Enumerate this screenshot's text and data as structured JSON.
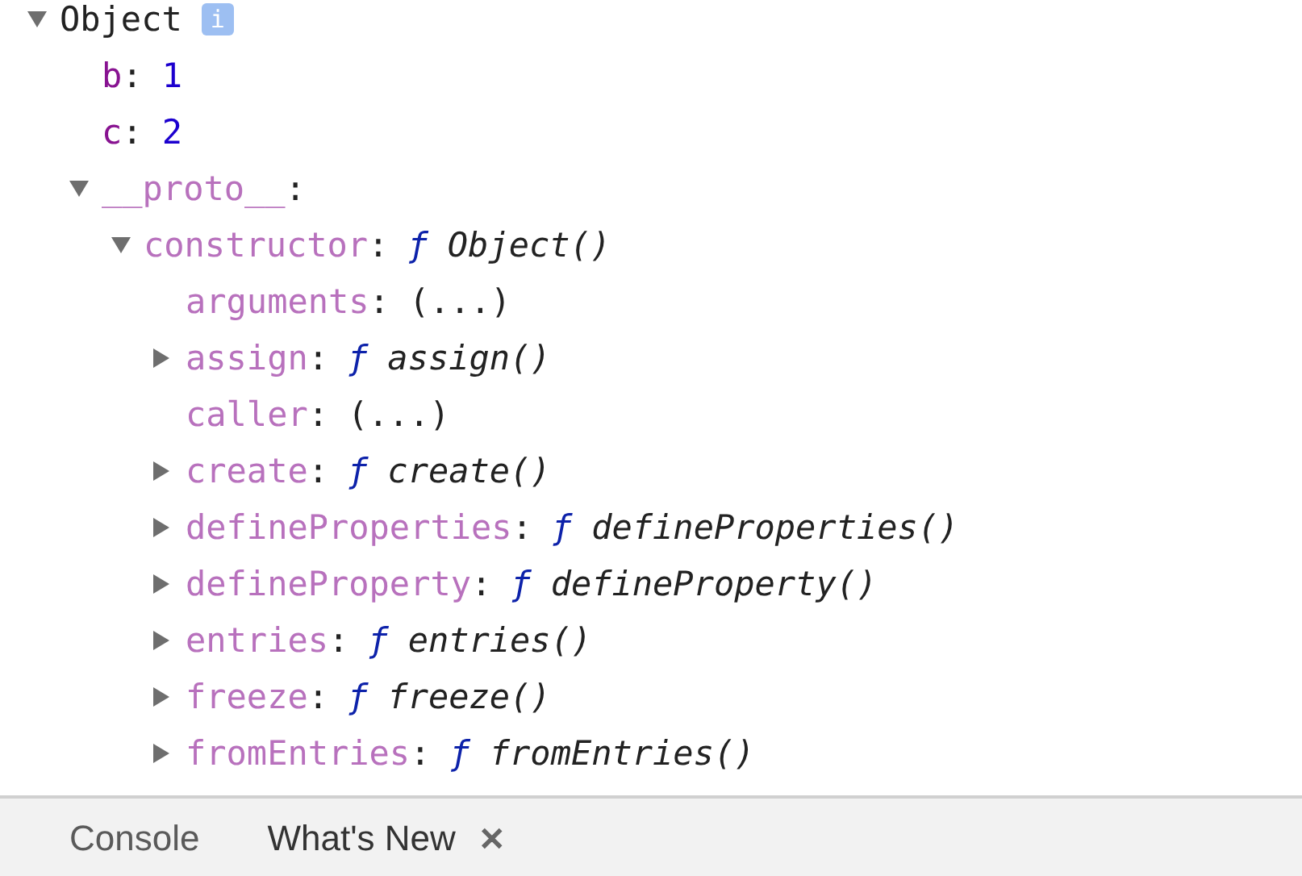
{
  "tree": {
    "label": "Object",
    "info": "i",
    "expanded": true,
    "children": [
      {
        "key": "b",
        "sep": ":",
        "enumerable": true,
        "kind": "number",
        "value": "1"
      },
      {
        "key": "c",
        "sep": ":",
        "enumerable": true,
        "kind": "number",
        "value": "2"
      },
      {
        "key": "__proto__",
        "sep": ":",
        "enumerable": false,
        "expanded": true,
        "children": [
          {
            "key": "constructor",
            "sep": ":",
            "enumerable": false,
            "expanded": true,
            "kind": "function",
            "marker": "ƒ",
            "value": "Object()",
            "children": [
              {
                "key": "arguments",
                "sep": ":",
                "enumerable": false,
                "kind": "getter",
                "value": "(...)"
              },
              {
                "key": "assign",
                "sep": ":",
                "enumerable": false,
                "expanded": false,
                "kind": "function",
                "marker": "ƒ",
                "value": "assign()"
              },
              {
                "key": "caller",
                "sep": ":",
                "enumerable": false,
                "kind": "getter",
                "value": "(...)"
              },
              {
                "key": "create",
                "sep": ":",
                "enumerable": false,
                "expanded": false,
                "kind": "function",
                "marker": "ƒ",
                "value": "create()"
              },
              {
                "key": "defineProperties",
                "sep": ":",
                "enumerable": false,
                "expanded": false,
                "kind": "function",
                "marker": "ƒ",
                "value": "defineProperties()"
              },
              {
                "key": "defineProperty",
                "sep": ":",
                "enumerable": false,
                "expanded": false,
                "kind": "function",
                "marker": "ƒ",
                "value": "defineProperty()"
              },
              {
                "key": "entries",
                "sep": ":",
                "enumerable": false,
                "expanded": false,
                "kind": "function",
                "marker": "ƒ",
                "value": "entries()"
              },
              {
                "key": "freeze",
                "sep": ":",
                "enumerable": false,
                "expanded": false,
                "kind": "function",
                "marker": "ƒ",
                "value": "freeze()"
              },
              {
                "key": "fromEntries",
                "sep": ":",
                "enumerable": false,
                "expanded": false,
                "kind": "function",
                "marker": "ƒ",
                "value": "fromEntries()"
              }
            ]
          }
        ]
      }
    ]
  },
  "drawer_tabs": [
    {
      "label": "Console",
      "selected": false
    },
    {
      "label": "What's New",
      "selected": true,
      "close": "✕"
    }
  ]
}
